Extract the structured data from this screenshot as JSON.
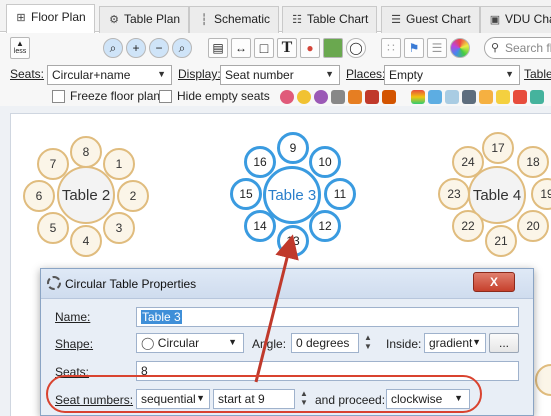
{
  "tabs": [
    {
      "icon": "grid-icon",
      "glyph": "⊞",
      "label": "Floor Plan"
    },
    {
      "icon": "gear-icon",
      "glyph": "⚙",
      "label": "Table Plan"
    },
    {
      "icon": "schematic-icon",
      "glyph": "┆",
      "label": "Schematic"
    },
    {
      "icon": "table-chart-icon",
      "glyph": "☷",
      "label": "Table Chart"
    },
    {
      "icon": "guest-chart-icon",
      "glyph": "☰",
      "label": "Guest Chart"
    },
    {
      "icon": "vdu-icon",
      "glyph": "▣",
      "label": "VDU Cha"
    }
  ],
  "toolbar": {
    "less_label": "less",
    "search_placeholder": "Search flo"
  },
  "options": {
    "seats_label": "Seats:",
    "seats_value": "Circular+name",
    "display_label": "Display:",
    "display_value": "Seat number",
    "places_label": "Places:",
    "places_value": "Empty",
    "table_label": "Table",
    "freeze_label": "Freeze floor plan",
    "hide_empty_label": "Hide empty seats"
  },
  "tables": [
    {
      "name": "Table 2",
      "seats": [
        "8",
        "1",
        "2",
        "3",
        "4",
        "5",
        "6",
        "7"
      ]
    },
    {
      "name": "Table 3",
      "seats": [
        "9",
        "10",
        "11",
        "12",
        "13",
        "14",
        "15",
        "16"
      ]
    },
    {
      "name": "Table 4",
      "seats": [
        "17",
        "18",
        "19",
        "20",
        "21",
        "22",
        "23",
        "24"
      ]
    }
  ],
  "dialog": {
    "title": "Circular Table Properties",
    "close_label": "X",
    "name_label": "Name:",
    "name_value": "Table 3",
    "shape_label": "Shape:",
    "shape_value": "Circular",
    "angle_label": "Angle:",
    "angle_value": "0 degrees",
    "inside_label": "Inside:",
    "inside_value": "gradient",
    "more_label": "...",
    "seats_label": "Seats:",
    "seats_value": "8",
    "seat_numbers_label": "Seat numbers:",
    "seat_numbers_value": "sequential",
    "start_value": "start at 9",
    "proceed_label": "and proceed:",
    "proceed_value": "clockwise"
  },
  "colors": {
    "selected": "#3a9be0",
    "unselected": "#e0bc7e",
    "annotation": "#d9432f"
  }
}
